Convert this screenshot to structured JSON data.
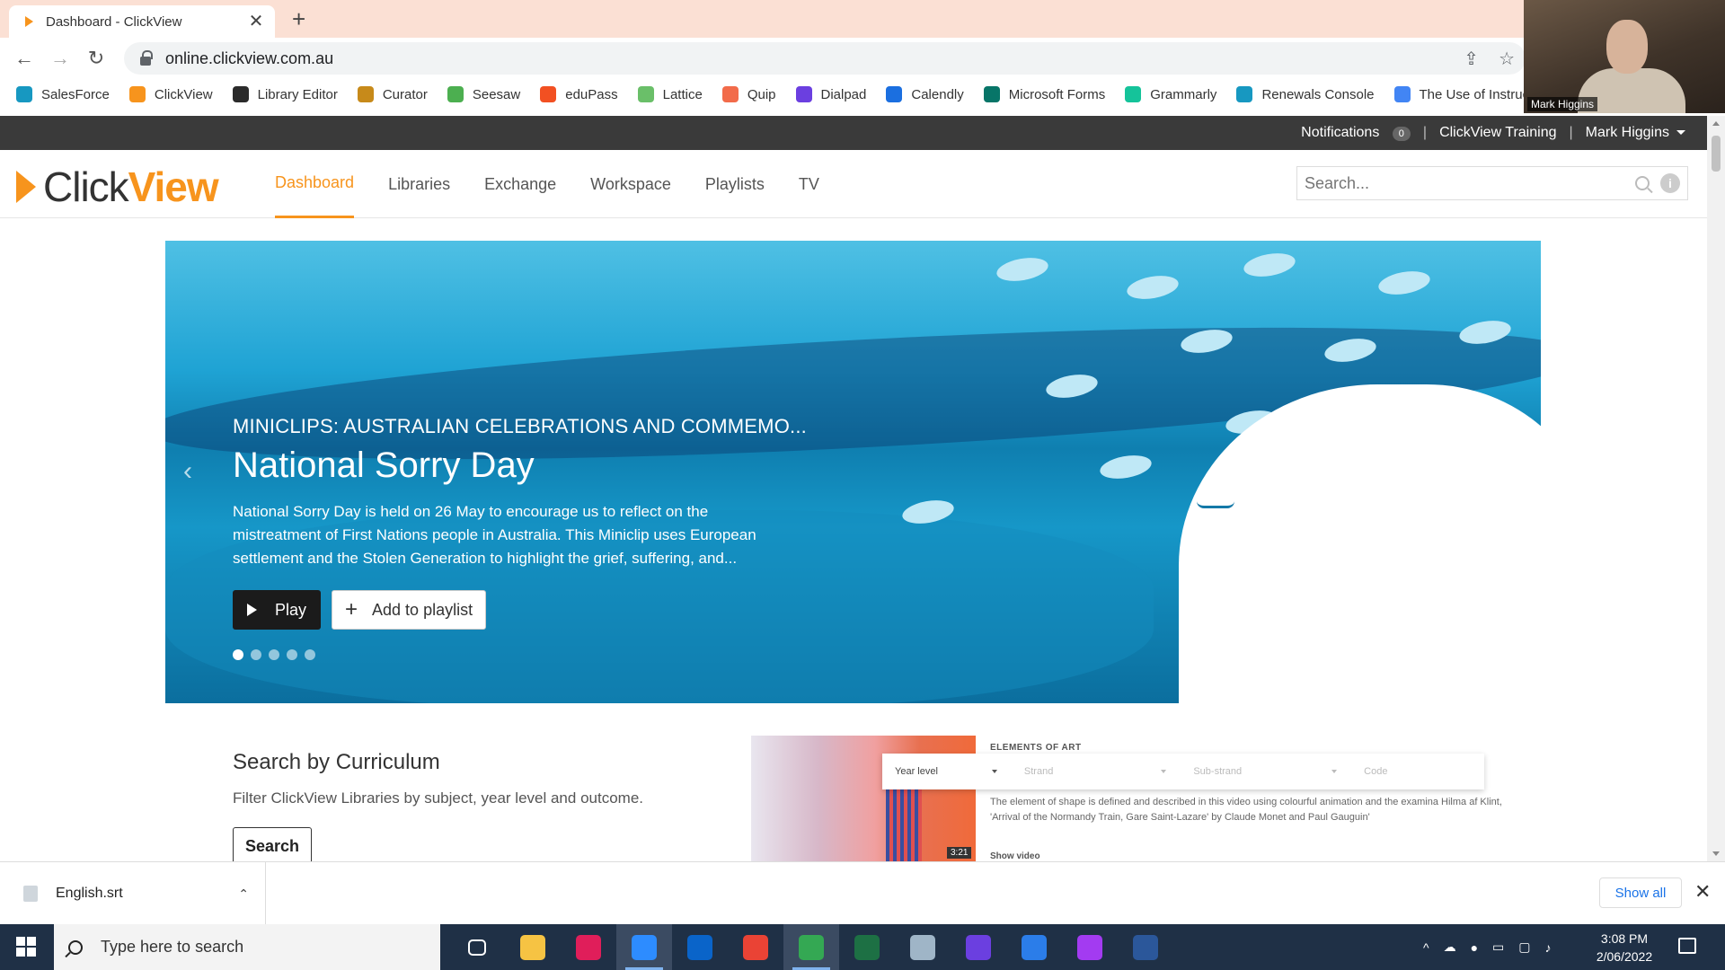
{
  "browser": {
    "tab_title": "Dashboard - ClickView",
    "tab_close": "✕",
    "new_tab": "+",
    "url": "online.clickview.com.au",
    "back": "←",
    "forward": "→",
    "reload": "↻",
    "share_icon": "⇪",
    "star_icon": "☆",
    "bookmarks": [
      {
        "label": "SalesForce",
        "color": "#1798c1"
      },
      {
        "label": "ClickView",
        "color": "#f7941d"
      },
      {
        "label": "Library Editor",
        "color": "#2b2b2b"
      },
      {
        "label": "Curator",
        "color": "#c78a1a"
      },
      {
        "label": "Seesaw",
        "color": "#4caf50"
      },
      {
        "label": "eduPass",
        "color": "#f25022"
      },
      {
        "label": "Lattice",
        "color": "#6abf69"
      },
      {
        "label": "Quip",
        "color": "#f26b4a"
      },
      {
        "label": "Dialpad",
        "color": "#6b3fe0"
      },
      {
        "label": "Calendly",
        "color": "#1b6fe0"
      },
      {
        "label": "Microsoft Forms",
        "color": "#077568"
      },
      {
        "label": "Grammarly",
        "color": "#15c39a"
      },
      {
        "label": "Renewals Console",
        "color": "#1798c1"
      },
      {
        "label": "The Use of Instructi...",
        "color": "#4285f4"
      }
    ]
  },
  "webcam": {
    "label": "Mark Higgins"
  },
  "site_topbar": {
    "notifications": "Notifications",
    "notifications_count": "0",
    "separator": "|",
    "org": "ClickView Training",
    "user": "Mark Higgins"
  },
  "logo": {
    "word1": "Click",
    "word2": "View"
  },
  "nav": [
    {
      "label": "Dashboard",
      "active": true
    },
    {
      "label": "Libraries"
    },
    {
      "label": "Exchange"
    },
    {
      "label": "Workspace"
    },
    {
      "label": "Playlists"
    },
    {
      "label": "TV"
    }
  ],
  "site_search": {
    "placeholder": "Search...",
    "info": "i"
  },
  "hero": {
    "subtitle": "MINICLIPS: AUSTRALIAN CELEBRATIONS AND COMMEMO...",
    "title": "National Sorry Day",
    "description": "National Sorry Day is held on 26 May to encourage us to reflect on the mistreatment of First Nations people in Australia. This Miniclip uses European settlement and the Stolen Generation to highlight the grief, suffering, and...",
    "play_label": "Play",
    "add_label": "Add to playlist",
    "add_icon": "+",
    "prev_arrow": "‹",
    "next_arrow": "›",
    "slides_total": 5,
    "slide_active": 1
  },
  "curriculum": {
    "title": "Search by Curriculum",
    "description": "Filter ClickView Libraries by subject, year level and outcome.",
    "button": "Search",
    "preview": {
      "heading": "ELEMENTS OF ART",
      "filter_year": "Year level",
      "filter_strand": "Strand",
      "filter_substrand": "Sub-strand",
      "filter_code": "Code",
      "text": "The element of shape is defined and described in this video using colourful animation and the examina Hilma af Klint, 'Arrival of the Normandy Train, Gare Saint-Lazare' by Claude Monet and Paul Gauguin'",
      "duration": "3:21",
      "show_video": "Show video"
    }
  },
  "download_bar": {
    "file_name": "English.srt",
    "expand": "⌃",
    "show_all": "Show all",
    "close": "✕"
  },
  "taskbar": {
    "search_placeholder": "Type here to search",
    "apps": [
      {
        "name": "task-view",
        "color": "#ffffff"
      },
      {
        "name": "file-explorer",
        "color": "#f6c343"
      },
      {
        "name": "slack",
        "color": "#e01e5a"
      },
      {
        "name": "zoom",
        "color": "#2d8cff",
        "active": true
      },
      {
        "name": "outlook",
        "color": "#0a64c9"
      },
      {
        "name": "chrome",
        "color": "#ea4335"
      },
      {
        "name": "chrome-profile",
        "color": "#34a853",
        "active": true
      },
      {
        "name": "excel",
        "color": "#1d7044"
      },
      {
        "name": "paint",
        "color": "#9fb5c7"
      },
      {
        "name": "dialpad",
        "color": "#6b3fe0"
      },
      {
        "name": "todo",
        "color": "#2b7de9"
      },
      {
        "name": "messenger",
        "color": "#a33bf1"
      },
      {
        "name": "word",
        "color": "#2b579a"
      }
    ],
    "time": "3:08 PM",
    "date": "2/06/2022"
  }
}
